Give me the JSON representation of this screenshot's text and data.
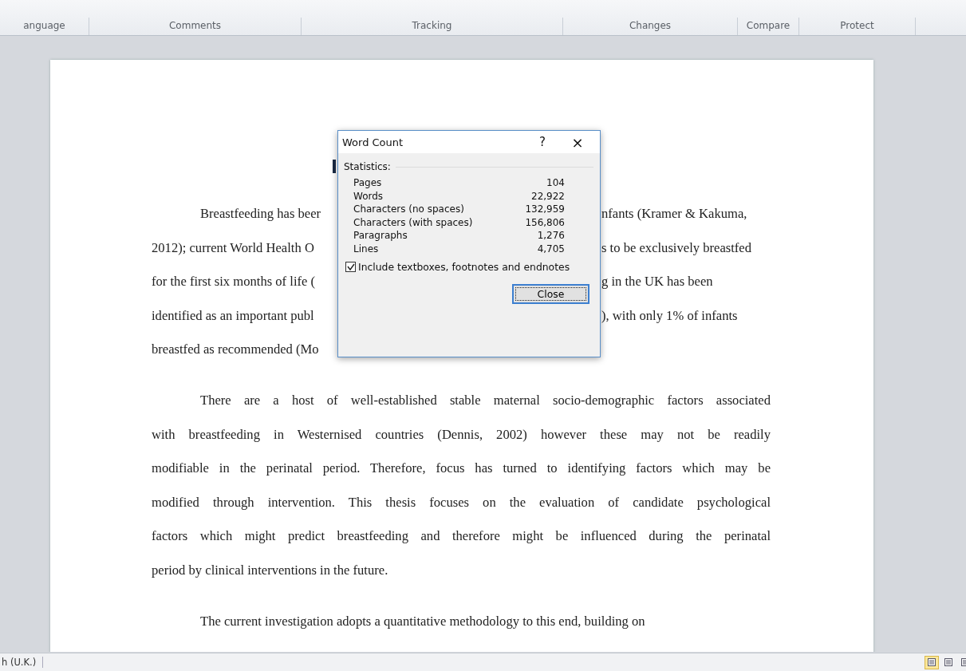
{
  "ribbon": {
    "groups": [
      "anguage",
      "Comments",
      "Tracking",
      "Changes",
      "Compare",
      "Protect"
    ]
  },
  "document": {
    "paragraphs": [
      {
        "lines": [
          {
            "left": "Breastfeeding has beer",
            "right": "nfants (Kramer & Kakuma,"
          },
          {
            "left": "2012); current World Health O",
            "right": "s to be exclusively breastfed"
          },
          {
            "left": "for the first six months of life (",
            "right": "g in the UK has been"
          },
          {
            "left": "identified as an important publ",
            "right": "), with only 1% of infants"
          },
          {
            "left": "breastfed as recommended (Mo"
          }
        ]
      },
      {
        "lines": [
          {
            "left": "There are a host of well-established stable maternal socio-demographic factors associated"
          },
          {
            "left": "with breastfeeding in Westernised countries (Dennis, 2002) however these may not be readily"
          },
          {
            "left": "modifiable in the perinatal period.  Therefore, focus has turned to identifying factors which may be"
          },
          {
            "left": "modified through intervention.  This thesis focuses on the evaluation of candidate psychological"
          },
          {
            "left": "factors which might predict breastfeeding and therefore might be influenced during the perinatal"
          },
          {
            "left": "period by clinical interventions in the future."
          }
        ]
      },
      {
        "lines": [
          {
            "left": "The current investigation adopts a quantitative methodology to this end, building on"
          }
        ]
      }
    ]
  },
  "dialog": {
    "title": "Word Count",
    "help": "?",
    "close_glyph": "×",
    "section": "Statistics:",
    "stats": [
      {
        "label": "Pages",
        "value": "104"
      },
      {
        "label": "Words",
        "value": "22,922"
      },
      {
        "label": "Characters (no spaces)",
        "value": "132,959"
      },
      {
        "label": "Characters (with spaces)",
        "value": "156,806"
      },
      {
        "label": "Paragraphs",
        "value": "1,276"
      },
      {
        "label": "Lines",
        "value": "4,705"
      }
    ],
    "checkbox": {
      "label": "Include textboxes, footnotes and endnotes",
      "checked": true
    },
    "button": "Close"
  },
  "status_bar": {
    "language": "h (U.K.)",
    "view_buttons": [
      {
        "selected": true
      },
      {
        "selected": false
      },
      {
        "selected": false
      }
    ]
  }
}
